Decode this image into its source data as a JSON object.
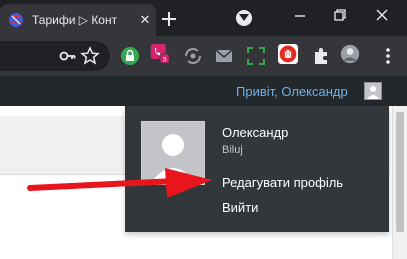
{
  "browser": {
    "tab": {
      "title": "Тарифи ▷ Конт"
    },
    "accent_colors": {
      "tab_bg": "#35363a",
      "frame_bg": "#202124"
    },
    "extensions": {
      "badge_count": "3"
    }
  },
  "wp_admin_bar": {
    "greeting": "Привіт, Олександр",
    "link_color": "#72aee6"
  },
  "user_menu": {
    "display_name": "Олександр",
    "username": "Biluj",
    "edit_profile": "Редагувати профіль",
    "logout": "Вийти"
  },
  "annotation": {
    "color": "#e8161c"
  }
}
